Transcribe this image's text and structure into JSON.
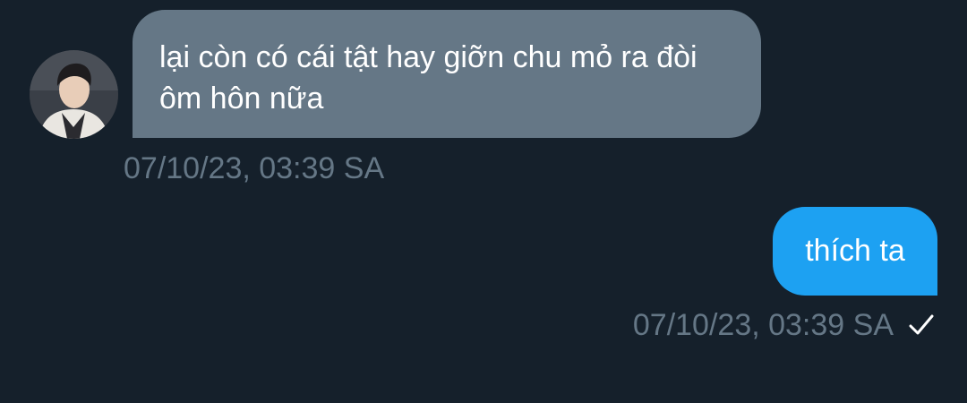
{
  "conversation": {
    "messages": [
      {
        "direction": "received",
        "text": "lại còn có cái tật hay giỡn chu mỏ ra đòi ôm hôn nữa",
        "timestamp": "07/10/23, 03:39 SA"
      },
      {
        "direction": "sent",
        "text": "thích ta",
        "timestamp": "07/10/23, 03:39 SA",
        "status_icon": "checkmark-icon"
      }
    ]
  },
  "colors": {
    "background": "#15202b",
    "received_bubble": "#657786",
    "sent_bubble": "#1da1f2",
    "timestamp_text": "#657786",
    "message_text": "#ffffff"
  }
}
